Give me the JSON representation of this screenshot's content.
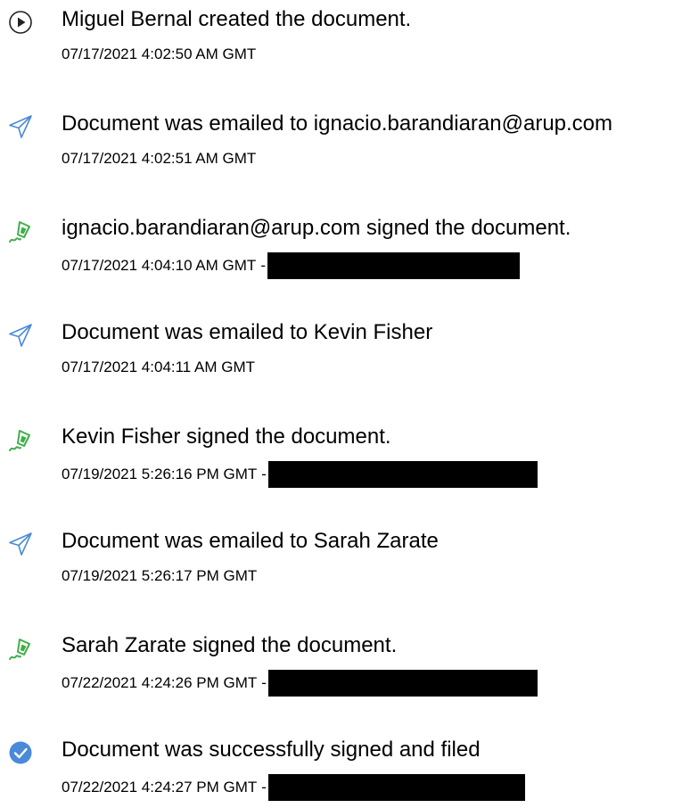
{
  "colors": {
    "send": "#4a8ad8",
    "sign": "#3fae49",
    "complete": "#4a8ad8",
    "create": "#222222",
    "redaction": "#000000"
  },
  "events": [
    {
      "icon": "play-circle-icon",
      "message": "Miguel Bernal created the document.",
      "timestamp": "07/17/2021 4:02:50 AM GMT",
      "redacted": false
    },
    {
      "icon": "send-icon",
      "message": "Document was emailed to ignacio.barandiaran@arup.com",
      "timestamp": "07/17/2021 4:02:51 AM GMT",
      "redacted": false
    },
    {
      "icon": "pen-sign-icon",
      "message": "ignacio.barandiaran@arup.com signed the document.",
      "timestamp": "07/17/2021 4:04:10 AM GMT",
      "separator": "-",
      "redacted": true
    },
    {
      "icon": "send-icon",
      "message": "Document was emailed to Kevin Fisher",
      "timestamp": "07/17/2021 4:04:11 AM GMT",
      "redacted": false
    },
    {
      "icon": "pen-sign-icon",
      "message": "Kevin Fisher signed the document.",
      "timestamp": "07/19/2021 5:26:16 PM GMT",
      "separator": "-",
      "redacted": true
    },
    {
      "icon": "send-icon",
      "message": "Document was emailed to Sarah Zarate",
      "timestamp": "07/19/2021 5:26:17 PM GMT",
      "redacted": false
    },
    {
      "icon": "pen-sign-icon",
      "message": "Sarah Zarate signed the document.",
      "timestamp": "07/22/2021 4:24:26 PM GMT",
      "separator": "-",
      "redacted": true
    },
    {
      "icon": "check-circle-icon",
      "message": "Document was successfully signed and filed",
      "timestamp": "07/22/2021 4:24:27 PM GMT",
      "separator": "-",
      "redacted": true
    }
  ]
}
